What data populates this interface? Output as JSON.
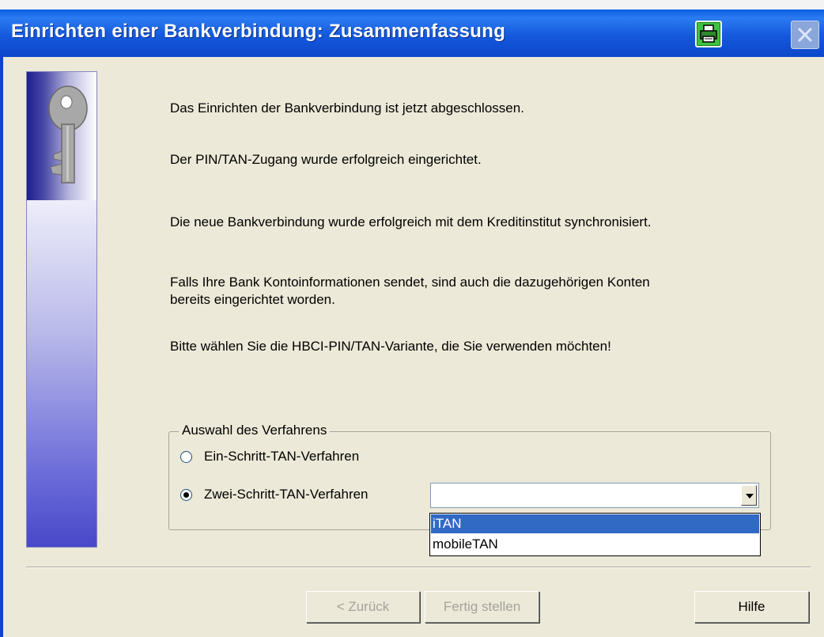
{
  "window": {
    "title": "Einrichten einer Bankverbindung: Zusammenfassung",
    "icons": {
      "print": "printer-icon",
      "close": "close-icon"
    }
  },
  "messages": {
    "completed": "Das Einrichten der Bankverbindung ist jetzt abgeschlossen.",
    "pin_tan": "Der PIN/TAN-Zugang wurde erfolgreich eingerichtet.",
    "synchronized": "Die neue Bankverbindung wurde erfolgreich mit dem Kreditinstitut synchronisiert.",
    "accounts_line1": "Falls Ihre Bank Kontoinformationen sendet, sind auch die dazugehörigen Konten",
    "accounts_line2": "bereits eingerichtet worden.",
    "choose_variant": "Bitte wählen Sie die HBCI-PIN/TAN-Variante, die Sie verwenden möchten!"
  },
  "procedure_group": {
    "legend": "Auswahl des Verfahrens",
    "options": [
      {
        "label": "Ein-Schritt-TAN-Verfahren",
        "selected": false
      },
      {
        "label": "Zwei-Schritt-TAN-Verfahren",
        "selected": true
      }
    ],
    "tan_combo": {
      "value": "",
      "options": [
        "iTAN",
        "mobileTAN"
      ],
      "highlighted": "iTAN"
    }
  },
  "buttons": {
    "back": "< Zurück",
    "finish": "Fertig stellen",
    "help": "Hilfe"
  },
  "colors": {
    "titlebar": "#0c47c9",
    "window_bg": "#ece9d8",
    "selection": "#316ac5"
  }
}
